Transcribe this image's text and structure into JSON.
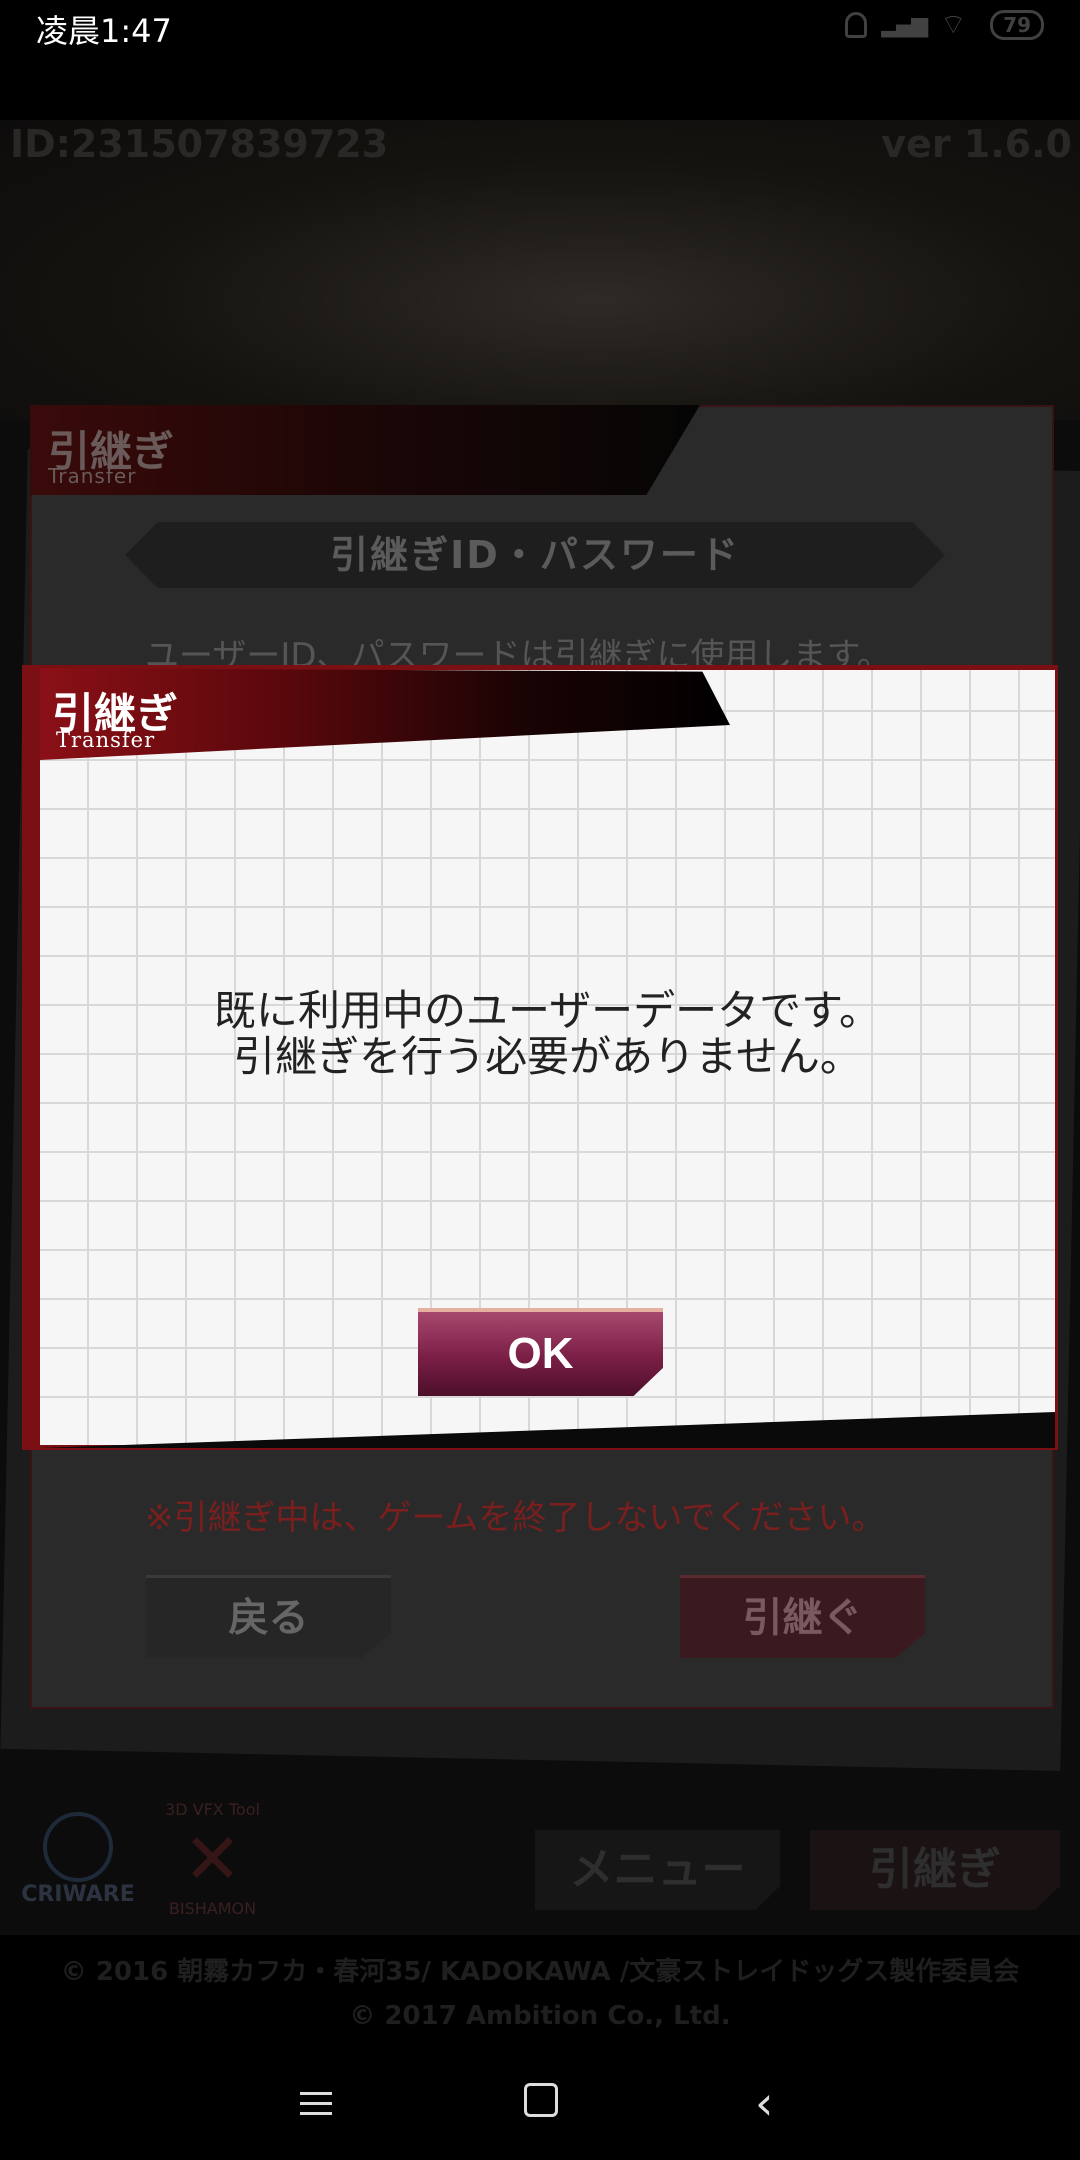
{
  "status_bar": {
    "time": "凌晨1:47",
    "battery": "79"
  },
  "background": {
    "user_id": "ID:231507839723",
    "version": "ver 1.6.0",
    "panel": {
      "title_jp": "引継ぎ",
      "title_en": "Transfer",
      "banner": "引継ぎID・パスワード",
      "description": "ユーザーID、パスワードは引継ぎに使用します。",
      "warning": "※引継ぎ中は、ゲームを終了しないでください。",
      "back_button": "戻る",
      "transfer_button": "引継ぐ"
    },
    "logos": {
      "criware": "CRIWARE",
      "bishamon_caption": "3D VFX Tool",
      "bishamon": "BISHAMON"
    },
    "menu_button": "メニュー",
    "transfer_menu_button": "引継ぎ",
    "copyright_line1": "© 2016 朝霧カフカ・春河35/ KADOKAWA /文豪ストレイドッグス製作委員会",
    "copyright_line2": "© 2017 Ambition Co., Ltd."
  },
  "dialog": {
    "title_jp": "引継ぎ",
    "title_en": "Transfer",
    "message_line1": "既に利用中のユーザーデータです。",
    "message_line2": "引継ぎを行う必要がありません。",
    "ok_label": "OK"
  }
}
